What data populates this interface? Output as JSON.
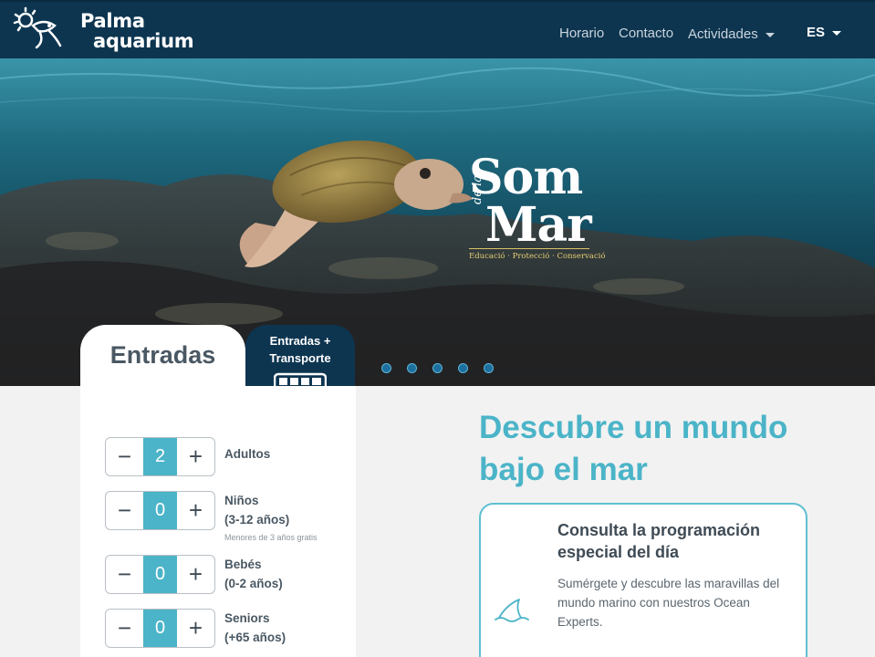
{
  "header": {
    "logo": {
      "line1": "Palma",
      "line2": "aquarium"
    },
    "nav": [
      {
        "label": "Horario"
      },
      {
        "label": "Contacto"
      },
      {
        "label": "Actividades",
        "dropdown": true
      },
      {
        "label": "ES",
        "dropdown": true
      }
    ]
  },
  "hero": {
    "brand": {
      "som": "Som",
      "de_la": "de la",
      "mar": "Mar",
      "tagline": "Educació · Protecció · Conservació"
    },
    "carousel": {
      "slides": 5
    }
  },
  "tickets": {
    "tabs": [
      {
        "label": "Entradas",
        "active": true
      },
      {
        "label": "Entradas + Transporte",
        "icon": "bus-icon",
        "active": false
      }
    ],
    "rows": [
      {
        "label": "Adultos",
        "sub": "",
        "value": "2",
        "note": ""
      },
      {
        "label": "Niños",
        "sub": "(3-12 años)",
        "value": "0",
        "note": "Menores de 3 años gratis"
      },
      {
        "label": "Bebés",
        "sub": "(0-2 años)",
        "value": "0",
        "note": ""
      },
      {
        "label": "Seniors",
        "sub": "(+65 años)",
        "value": "0",
        "note": ""
      }
    ],
    "minus_symbol": "−",
    "plus_symbol": "+"
  },
  "main": {
    "heading": "Descubre un mundo bajo el mar",
    "card": {
      "icon": "shark-fin-icon",
      "title": "Consulta la programación especial del día",
      "body": "Sumérgete y descubre las maravillas del mundo marino con nuestros Ocean Experts."
    }
  },
  "colors": {
    "navbar": "#0d3550",
    "accent": "#4bb4c8",
    "text_dark": "#4a5863"
  }
}
